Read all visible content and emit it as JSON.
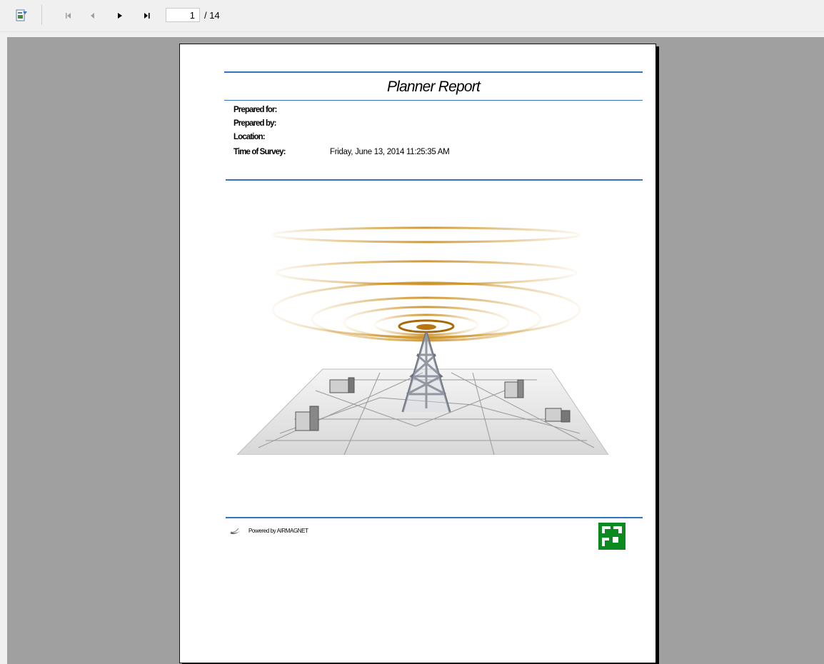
{
  "toolbar": {
    "export_icon": "export-report-icon",
    "first_icon": "first-page-icon",
    "prev_icon": "previous-page-icon",
    "next_icon": "next-page-icon",
    "last_icon": "last-page-icon",
    "current_page": "1",
    "total_pages": "/ 14"
  },
  "report": {
    "title": "Planner Report",
    "fields": [
      {
        "label": "Prepared for:",
        "value": ""
      },
      {
        "label": "Prepared by:",
        "value": ""
      },
      {
        "label": "Location:",
        "value": ""
      },
      {
        "label": "Time of Survey:",
        "value": "Friday, June 13, 2014 11:25:35 AM"
      }
    ],
    "hero_image": "radio-tower-over-city-map-illustration",
    "footer_text": "Powered by AIRMAGNET",
    "footer_icon": "airmagnet-swoosh-icon",
    "logo": "green-company-logo-icon"
  },
  "colors": {
    "rule": "#2f75c2",
    "viewer_background": "#a0a0a0",
    "logo_green": "#0a8a1f",
    "signal_gold": "#c8860e"
  }
}
